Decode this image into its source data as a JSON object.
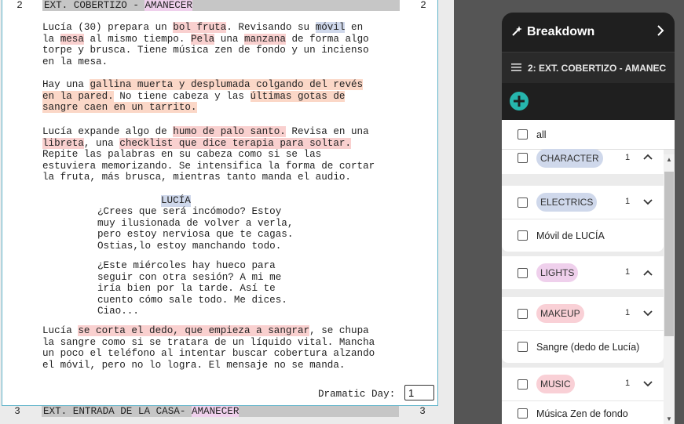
{
  "script": {
    "scene2": {
      "number": "2",
      "heading_prefix": "EXT. COBERTIZO - ",
      "heading_time": "AMANECER"
    },
    "para1": {
      "line1_a": "Lucía (30) prepara un ",
      "line1_b": "bol fruta",
      "line1_c": ". Revisando su ",
      "line1_d": "móvil",
      "line1_e": " en",
      "line2_a": "la ",
      "line2_b": "mesa",
      "line2_c": " al mismo tiempo. ",
      "line2_d": "Pela",
      "line2_e": " una ",
      "line2_f": "manzana",
      "line2_g": " de forma algo",
      "line3": "torpe y brusca. Tiene música zen de fondo y un incienso",
      "line4": "en la mesa."
    },
    "para2": {
      "line1_a": "Hay una ",
      "line1_b": "gallina muerta y desplumada colgando del revés",
      "line2_a": "en la pared.",
      "line2_b": " No tiene cabeza y las ",
      "line2_c": "últimas gotas de",
      "line3": "sangre caen en un tarrito."
    },
    "para3": {
      "line1_a": "Lucía expande algo de ",
      "line1_b": "humo de palo santo.",
      "line1_c": " Revisa en una",
      "line2_a": "libreta",
      "line2_b": ", una ",
      "line2_c": "checklist que dice terapia para soltar.",
      "line3": "Repite las palabras en su cabeza como si se las",
      "line4": "estuviera memorizando. Se intensifica la forma de cortar",
      "line5": "la fruta, más brusca, mientras tanto manda el audio."
    },
    "character": "LUCÍA",
    "dialog1": "¿Crees que será incómodo? Estoy\nmuy ilusionada de volver a verla,\npero estoy nerviosa que te cagas.\nOstias,lo estoy manchando todo.",
    "dialog2": "¿Este miércoles hay hueco para\nseguir con otra sesión? A mi me\niría bien por la tarde. Así te\ncuento cómo sale todo. Me dices.\nCiao...",
    "para4": {
      "line1_a": "Lucía ",
      "line1_b": "se corta el dedo, que empieza a sangrar",
      "line1_c": ", se chupa",
      "line2": "la sangre como si se tratara de un líquido vital. Mancha",
      "line3": "un poco el teléfono al intentar buscar cobertura alzando",
      "line4": "el móvil, pero no lo logra. El mensaje no se manda."
    },
    "dramatic_day_label": "Dramatic Day:",
    "dramatic_day_value": "1",
    "scene3": {
      "number": "3",
      "heading_prefix": "EXT. ENTRADA DE LA CASA- ",
      "heading_time": "AMANECER"
    }
  },
  "panel": {
    "title": "Breakdown",
    "scene_label": "2: EXT. COBERTIZO - AMANEC",
    "all_label": "all",
    "categories": [
      {
        "name": "CHARACTER",
        "count": "1",
        "color": "#cfd8eb",
        "expanded": true
      },
      {
        "name": "ELECTRICS",
        "count": "1",
        "color": "#cfd8eb",
        "expanded": false,
        "item": "Móvil de LUCÍA"
      },
      {
        "name": "LIGHTS",
        "count": "1",
        "color": "#efd0ec",
        "expanded": true
      },
      {
        "name": "MAKEUP",
        "count": "1",
        "color": "#f9d0d6",
        "expanded": false,
        "item": "Sangre (dedo de Lucía)"
      },
      {
        "name": "MUSIC",
        "count": "1",
        "color": "#f9d0d6",
        "expanded": false
      }
    ],
    "cut_off_item": "Música Zen de fondo"
  }
}
